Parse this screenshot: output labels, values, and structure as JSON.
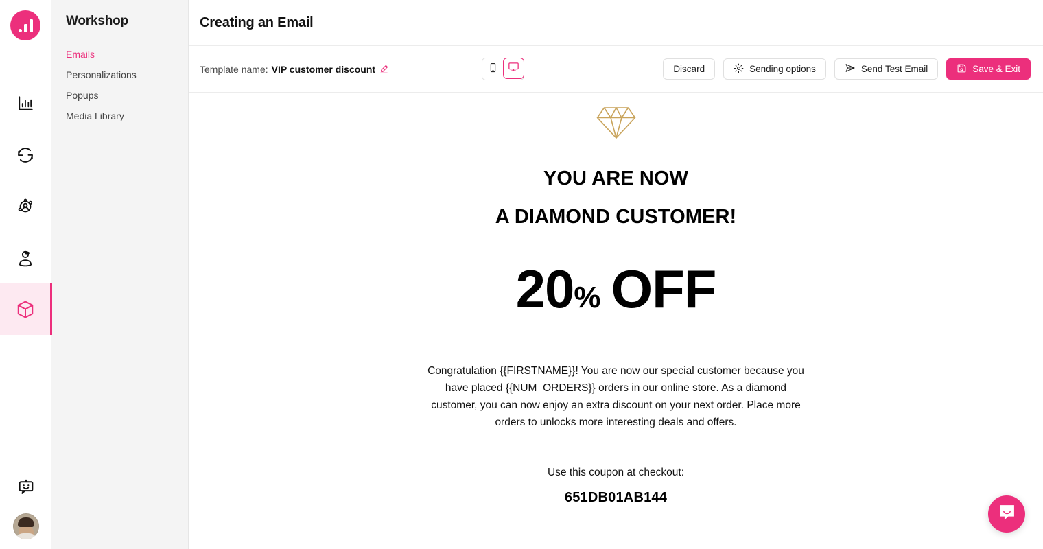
{
  "theme": {
    "accent": "#ec2f7c",
    "accent_soft": "#fde9f1",
    "sidebar_bg": "#f4f4f4",
    "text": "#111111",
    "gold": "#c9a45c"
  },
  "rail": {
    "logo": {
      "icon": "bar-chart-logo-icon",
      "alt": "Workshop logo"
    },
    "items": [
      {
        "icon": "analytics-bar-chart-icon",
        "active": false
      },
      {
        "icon": "sync-refresh-icon",
        "active": false
      },
      {
        "icon": "audience-contacts-icon",
        "active": false
      },
      {
        "icon": "customer-profile-icon",
        "active": false
      },
      {
        "icon": "workshop-cube-icon",
        "active": true
      }
    ],
    "bottom": [
      {
        "icon": "chat-bot-icon"
      }
    ],
    "avatar": {
      "icon": "user-avatar",
      "alt": "User profile photo"
    }
  },
  "sidebar": {
    "title": "Workshop",
    "items": [
      {
        "label": "Emails",
        "active": true
      },
      {
        "label": "Personalizations",
        "active": false
      },
      {
        "label": "Popups",
        "active": false
      },
      {
        "label": "Media Library",
        "active": false
      }
    ]
  },
  "header": {
    "title": "Creating an Email"
  },
  "toolbar": {
    "template_label": "Template name:",
    "template_value": "VIP customer discount",
    "edit_icon": "pencil-edit-icon",
    "devices": [
      {
        "name": "mobile",
        "icon": "mobile-phone-icon",
        "active": false
      },
      {
        "name": "desktop",
        "icon": "desktop-monitor-icon",
        "active": true
      }
    ],
    "discard_label": "Discard",
    "sending_options_label": "Sending options",
    "sending_options_icon": "gear-icon",
    "send_test_label": "Send Test Email",
    "send_test_icon": "paper-plane-icon",
    "save_exit_label": "Save & Exit",
    "save_exit_icon": "save-disk-icon"
  },
  "email": {
    "hero_icon": "diamond-icon",
    "headline_line1": "YOU ARE NOW",
    "headline_line2": "A DIAMOND CUSTOMER!",
    "offer_number": "20",
    "offer_percent": "%",
    "offer_word": "OFF",
    "body": "Congratulation {{FIRSTNAME}}! You are now our special customer because you have placed {{NUM_ORDERS}} orders in our online store. As a diamond customer, you can now enjoy an extra discount on your next order.  Place more orders to unlocks more interesting deals and offers.",
    "coupon_label": "Use this coupon at checkout:",
    "coupon_code": "651DB01AB144"
  },
  "chat": {
    "icon": "chat-bubble-smile-icon",
    "title": "Open chat"
  }
}
